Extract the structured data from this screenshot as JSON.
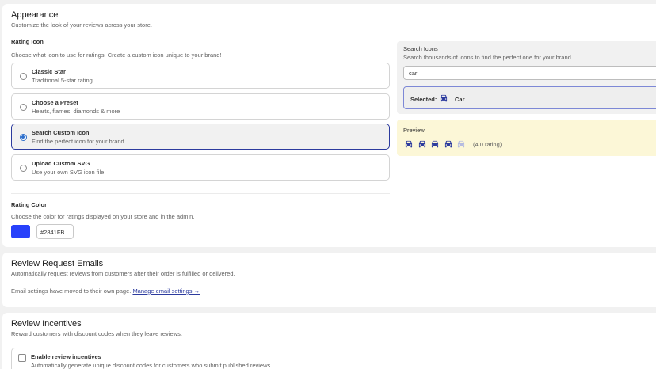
{
  "appearance": {
    "title": "Appearance",
    "subtitle": "Customize the look of your reviews across your store.",
    "rating_icon": {
      "label": "Rating Icon",
      "description": "Choose what icon to use for ratings. Create a custom icon unique to your brand!",
      "options": [
        {
          "title": "Classic Star",
          "desc": "Traditional 5-star rating",
          "selected": false
        },
        {
          "title": "Choose a Preset",
          "desc": "Hearts, flames, diamonds & more",
          "selected": false
        },
        {
          "title": "Search Custom Icon",
          "desc": "Find the perfect icon for your brand",
          "selected": true
        },
        {
          "title": "Upload Custom SVG",
          "desc": "Use your own SVG icon file",
          "selected": false
        }
      ]
    },
    "rating_color": {
      "label": "Rating Color",
      "description": "Choose the color for ratings displayed on your store and in the admin.",
      "value": "#2841FB"
    },
    "search_icons": {
      "title": "Search Icons",
      "subtitle": "Search thousands of icons to find the perfect one for your brand.",
      "query": "car",
      "selected_label": "Selected:",
      "selected_name": "Car",
      "selected_icon": "car-icon"
    },
    "preview": {
      "title": "Preview",
      "rating_value": 4.0,
      "max_rating": 5,
      "rating_text": "(4.0 rating)",
      "filled_color": "#2c3b9e",
      "empty_color": "#b5bbe0"
    }
  },
  "emails": {
    "title": "Review Request Emails",
    "subtitle": "Automatically request reviews from customers after their order is fulfilled or delivered.",
    "moved_text": "Email settings have moved to their own page.",
    "manage_link": "Manage email settings →"
  },
  "incentives": {
    "title": "Review Incentives",
    "subtitle": "Reward customers with discount codes when they leave reviews.",
    "enable_label": "Enable review incentives",
    "enable_desc": "Automatically generate unique discount codes for customers who submit published reviews.",
    "enabled": false
  }
}
